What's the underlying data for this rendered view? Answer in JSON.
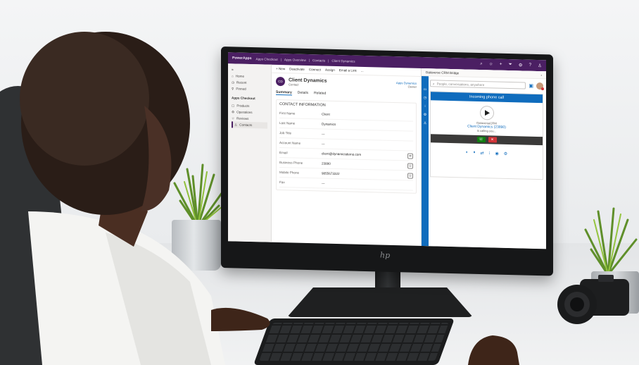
{
  "app": {
    "brand": "PowerApps",
    "breadcrumbs": [
      "Apps Checkout",
      "Apps Overview",
      "Contacts",
      "Client Dynamics"
    ],
    "topbar_icons": [
      "search-icon",
      "lightbulb-icon",
      "plus-icon",
      "filter-icon",
      "gear-icon",
      "help-icon",
      "user-icon"
    ]
  },
  "sidebar": {
    "items": [
      {
        "label": "Home",
        "icon": "home-icon"
      },
      {
        "label": "Recent",
        "icon": "clock-icon"
      },
      {
        "label": "Pinned",
        "icon": "pin-icon"
      }
    ],
    "section": "Apps Checkout",
    "section_items": [
      {
        "label": "Products",
        "icon": "box-icon"
      },
      {
        "label": "Operations",
        "icon": "gear-icon"
      },
      {
        "label": "Reviews",
        "icon": "star-icon"
      },
      {
        "label": "Contacts",
        "icon": "person-icon",
        "active": true
      }
    ]
  },
  "command_bar": {
    "items": [
      "+ New",
      "Deactivate",
      "Connect",
      "Assign",
      "Email a Link",
      "..."
    ]
  },
  "record": {
    "initials": "CD",
    "title": "Client Dynamics",
    "subtitle": "Contact",
    "owner": "Apps Dynamics",
    "owner_label": "Owner",
    "tabs": [
      "Summary",
      "Details",
      "Related"
    ],
    "section_title": "CONTACT INFORMATION",
    "fields": [
      {
        "label": "First Name",
        "value": "Client"
      },
      {
        "label": "Last Name",
        "value": "Dynamics"
      },
      {
        "label": "Job Title",
        "value": "---"
      },
      {
        "label": "Account Name",
        "value": "---"
      },
      {
        "label": "Email",
        "value": "client@dynamicsdemo.com"
      },
      {
        "label": "Business Phone",
        "value": "23890"
      },
      {
        "label": "Mobile Phone",
        "value": "9855673322"
      },
      {
        "label": "Fax",
        "value": "---"
      }
    ]
  },
  "bridge": {
    "title": "Dataverse CRM Bridge",
    "search_placeholder": "People, conversations, anywhere",
    "incoming_label": "Incoming phone call",
    "caller_logo_caption": "DataverseCRM",
    "caller_name": "Client Dynamics (23890)",
    "caller_status": "is calling you...",
    "accept_icon": "phone-icon",
    "reject_icon": "close-icon"
  },
  "colors": {
    "topbar": "#4b1f63",
    "accent": "#0f6cbd",
    "accept": "#107c10",
    "reject": "#d13438"
  },
  "monitor_brand": "hp"
}
